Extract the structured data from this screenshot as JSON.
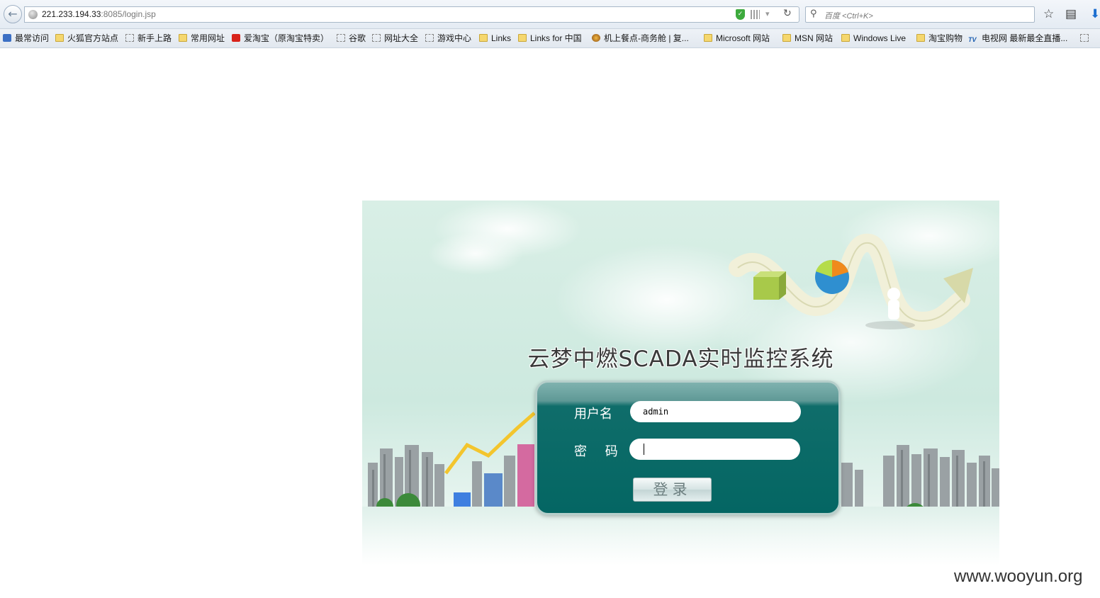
{
  "browser": {
    "url_host": "221.233.194.33",
    "url_path": ":8085/login.jsp",
    "search_placeholder": "百度 <Ctrl+K>"
  },
  "bookmarks": [
    {
      "label": "最常访问",
      "icon": "blue"
    },
    {
      "label": "火狐官方站点",
      "icon": "folder"
    },
    {
      "label": "新手上路",
      "icon": "dashed"
    },
    {
      "label": "常用网址",
      "icon": "folder"
    },
    {
      "label": "爱淘宝（原淘宝特卖）",
      "icon": "red"
    },
    {
      "label": "谷歌",
      "icon": "dashed"
    },
    {
      "label": "网址大全",
      "icon": "dashed"
    },
    {
      "label": "游戏中心",
      "icon": "dashed"
    },
    {
      "label": "Links",
      "icon": "folder"
    },
    {
      "label": "Links for 中国",
      "icon": "folder"
    },
    {
      "label": "机上餐点-商务舱 | 复...",
      "icon": "orb"
    },
    {
      "label": "Microsoft 网站",
      "icon": "folder"
    },
    {
      "label": "MSN 网站",
      "icon": "folder"
    },
    {
      "label": "Windows Live",
      "icon": "folder"
    },
    {
      "label": "淘宝购物",
      "icon": "folder"
    },
    {
      "label": "电视网 最新最全直播...",
      "icon": "tv"
    }
  ],
  "login": {
    "system_title": "云梦中燃SCADA实时监控系统",
    "username_label": "用户名",
    "username_value": "admin",
    "password_label": "密 码",
    "password_value": "",
    "submit_label": "登录"
  },
  "watermark": "www.wooyun.org",
  "colors": {
    "panel": "#046663",
    "sky": "#d9efe6"
  }
}
